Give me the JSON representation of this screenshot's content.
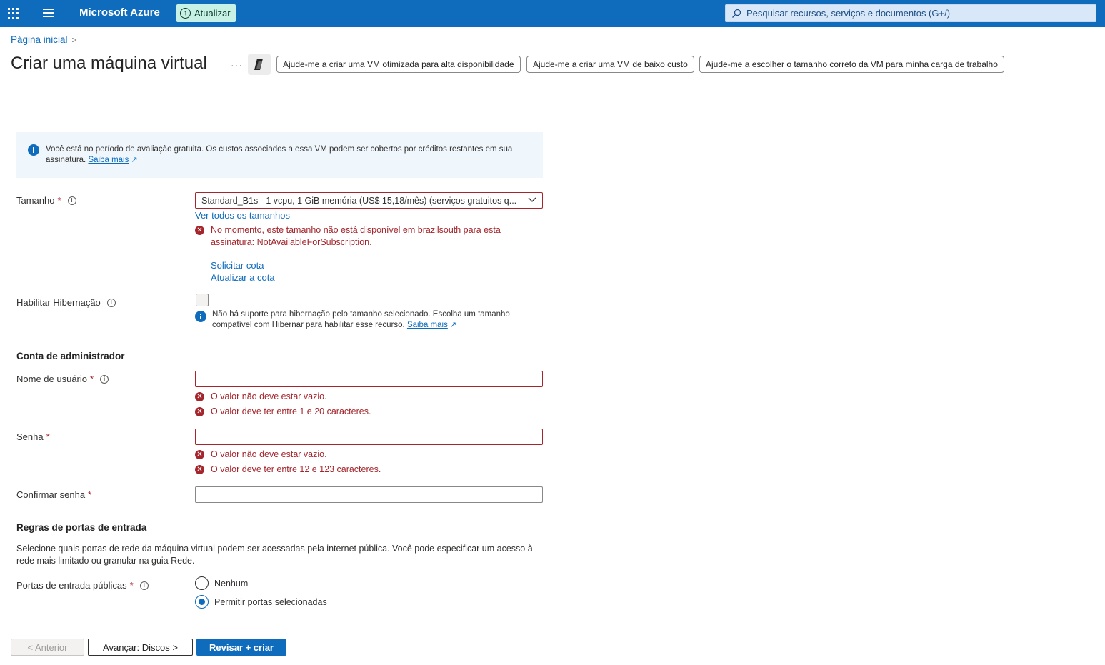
{
  "topbar": {
    "brand": "Microsoft Azure",
    "upgrade_label": "Atualizar",
    "search_placeholder": "Pesquisar recursos, serviços e documentos (G+/)"
  },
  "breadcrumb": {
    "home": "Página inicial",
    "separator": ">"
  },
  "page": {
    "title": "Criar uma máquina virtual",
    "more": "···",
    "suggestions": [
      "Ajude-me a criar uma VM otimizada para alta disponibilidade",
      "Ajude-me a criar uma VM de baixo custo",
      "Ajude-me a escolher o tamanho correto da VM para minha carga de trabalho"
    ]
  },
  "banner": {
    "text": "Você está no período de avaliação gratuita. Os custos associados a essa VM podem ser cobertos por créditos restantes em sua assinatura.",
    "link": "Saiba mais"
  },
  "size": {
    "label": "Tamanho",
    "required": "*",
    "value": "Standard_B1s - 1 vcpu, 1 GiB memória (US$ 15,18/mês)  (serviços gratuitos q...",
    "see_all": "Ver todos os tamanhos",
    "error": "No momento, este tamanho não está disponível em brazilsouth para esta assinatura: NotAvailableForSubscription.",
    "request_quota": "Solicitar cota",
    "update_quota": "Atualizar a cota"
  },
  "hibernation": {
    "label": "Habilitar Hibernação",
    "note": "Não há suporte para hibernação pelo tamanho selecionado. Escolha um tamanho compatível com Hibernar para habilitar esse recurso.",
    "link": "Saiba mais"
  },
  "admin": {
    "heading": "Conta de administrador",
    "username": {
      "label": "Nome de usuário",
      "required": "*",
      "value": "",
      "errors": [
        "O valor não deve estar vazio.",
        "O valor deve ter entre 1 e 20 caracteres."
      ]
    },
    "password": {
      "label": "Senha",
      "required": "*",
      "value": "",
      "errors": [
        "O valor não deve estar vazio.",
        "O valor deve ter entre 12 e 123 caracteres."
      ]
    },
    "confirm": {
      "label": "Confirmar senha",
      "required": "*",
      "value": ""
    }
  },
  "ports": {
    "heading": "Regras de portas de entrada",
    "description": "Selecione quais portas de rede da máquina virtual podem ser acessadas pela internet pública. Você pode especificar um acesso à rede mais limitado ou granular na guia Rede.",
    "label": "Portas de entrada públicas",
    "required": "*",
    "options": [
      "Nenhum",
      "Permitir portas selecionadas"
    ],
    "selected": "Permitir portas selecionadas"
  },
  "footer": {
    "prev": "< Anterior",
    "next": "Avançar: Discos >",
    "review": "Revisar + criar"
  },
  "colors": {
    "accent": "#0f6cbd",
    "error": "#a4262c",
    "topbar": "#0f6cbd",
    "info_bg": "#eff6fc"
  }
}
